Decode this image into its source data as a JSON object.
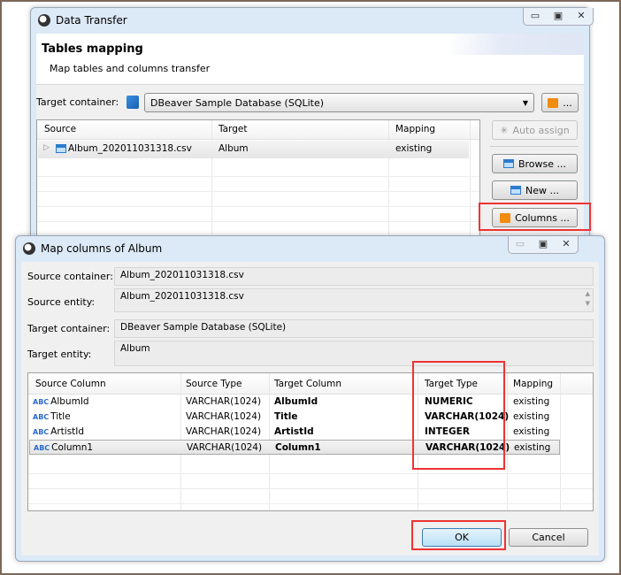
{
  "main_window": {
    "title": "Data Transfer",
    "page_title": "Tables mapping",
    "page_subtitle": "Map tables and columns transfer",
    "target_container_label": "Target container:",
    "target_container_value": "DBeaver Sample Database (SQLite)",
    "folder_button_label": "...",
    "table": {
      "headers": [
        "Source",
        "Target",
        "Mapping"
      ],
      "rows": [
        {
          "source": "Album_202011031318.csv",
          "target": "Album",
          "mapping": "existing"
        }
      ]
    },
    "buttons": {
      "auto_assign": "Auto assign",
      "browse": "Browse ...",
      "new": "New ...",
      "columns": "Columns ..."
    }
  },
  "dialog": {
    "title": "Map columns of Album",
    "source_container_label": "Source container:",
    "source_container_value": "Album_202011031318.csv",
    "source_entity_label": "Source entity:",
    "source_entity_value": "Album_202011031318.csv",
    "target_container_label": "Target container:",
    "target_container_value": "DBeaver Sample Database (SQLite)",
    "target_entity_label": "Target entity:",
    "target_entity_value": "Album",
    "table": {
      "headers": [
        "Source Column",
        "Source Type",
        "Target Column",
        "Target Type",
        "Mapping"
      ],
      "type_icon": "ABC",
      "rows": [
        {
          "source_column": "AlbumId",
          "source_type": "VARCHAR(1024)",
          "target_column": "AlbumId",
          "target_type": "NUMERIC",
          "mapping": "existing"
        },
        {
          "source_column": "Title",
          "source_type": "VARCHAR(1024)",
          "target_column": "Title",
          "target_type": "VARCHAR(1024)",
          "mapping": "existing"
        },
        {
          "source_column": "ArtistId",
          "source_type": "VARCHAR(1024)",
          "target_column": "ArtistId",
          "target_type": "INTEGER",
          "mapping": "existing"
        },
        {
          "source_column": "Column1",
          "source_type": "VARCHAR(1024)",
          "target_column": "Column1",
          "target_type": "VARCHAR(1024)",
          "mapping": "existing"
        }
      ]
    },
    "ok_label": "OK",
    "cancel_label": "Cancel"
  },
  "colors": {
    "highlight": "#ee3333",
    "title_bar": "#dce9f6",
    "accent_icon": "#2b7bd0",
    "folder": "#f08c10"
  }
}
